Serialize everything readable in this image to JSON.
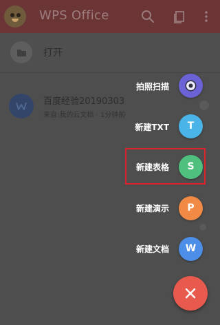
{
  "header": {
    "title": "WPS Office",
    "icons": [
      "avatar-icon",
      "search-icon",
      "multi-window-icon",
      "more-icon"
    ]
  },
  "list": {
    "open_label": "打开",
    "recent_doc": {
      "title": "百度经验20190303",
      "subtitle": "来自:我的云文档 · 1分钟前",
      "icon_letter": "W"
    }
  },
  "fab_menu": {
    "items": [
      {
        "label": "拍照扫描",
        "icon": "camera-icon",
        "glyph": "",
        "color": "#6b62d6"
      },
      {
        "label": "新建TXT",
        "icon": "txt-icon",
        "glyph": "T",
        "color": "#4ab3e8"
      },
      {
        "label": "新建表格",
        "icon": "spreadsheet-icon",
        "glyph": "S",
        "color": "#4fc07e"
      },
      {
        "label": "新建演示",
        "icon": "presentation-icon",
        "glyph": "P",
        "color": "#f08a45"
      },
      {
        "label": "新建文档",
        "icon": "document-icon",
        "glyph": "W",
        "color": "#4c8ee8"
      }
    ],
    "close_icon": "close-icon",
    "close_color": "#e8594e",
    "highlight_color": "#d8242a"
  }
}
